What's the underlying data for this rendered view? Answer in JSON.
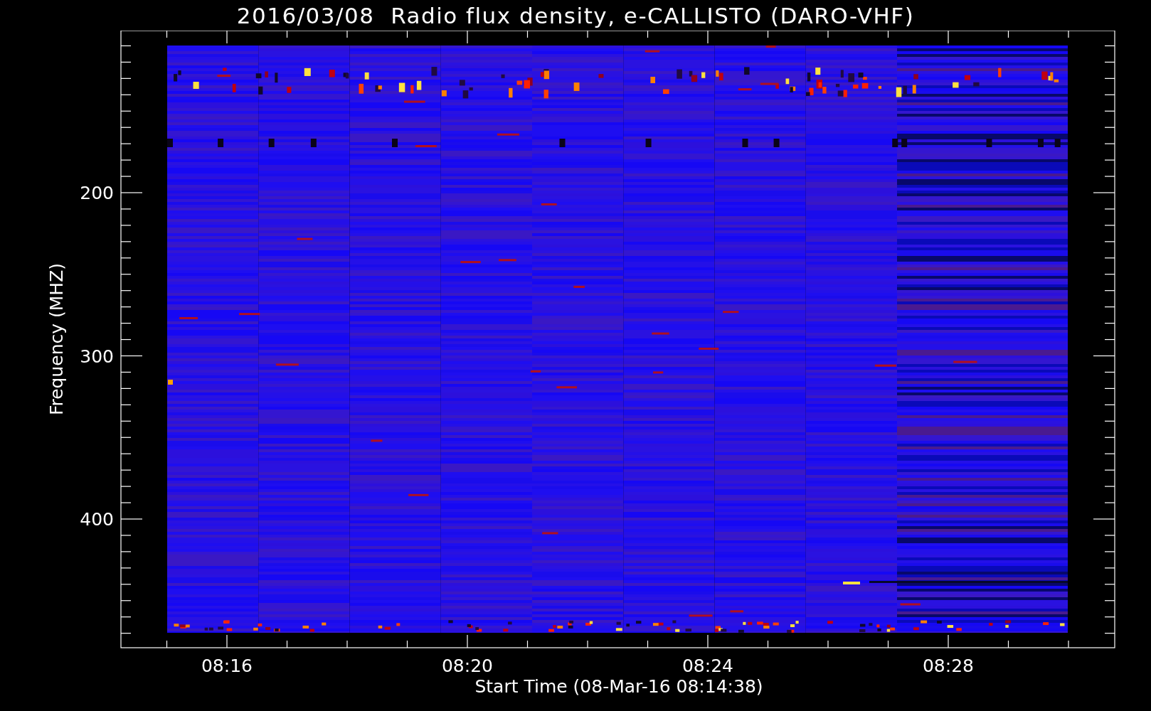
{
  "title": "2016/03/08  Radio flux density, e-CALLISTO (DARO-VHF)",
  "ylabel": "Frequency (MHZ)",
  "xlabel": "Start Time (08-Mar-16 08:14:38)",
  "y_tick_labels": [
    "200",
    "300",
    "400"
  ],
  "x_tick_labels": [
    "08:16",
    "08:20",
    "08:24",
    "08:28"
  ]
}
